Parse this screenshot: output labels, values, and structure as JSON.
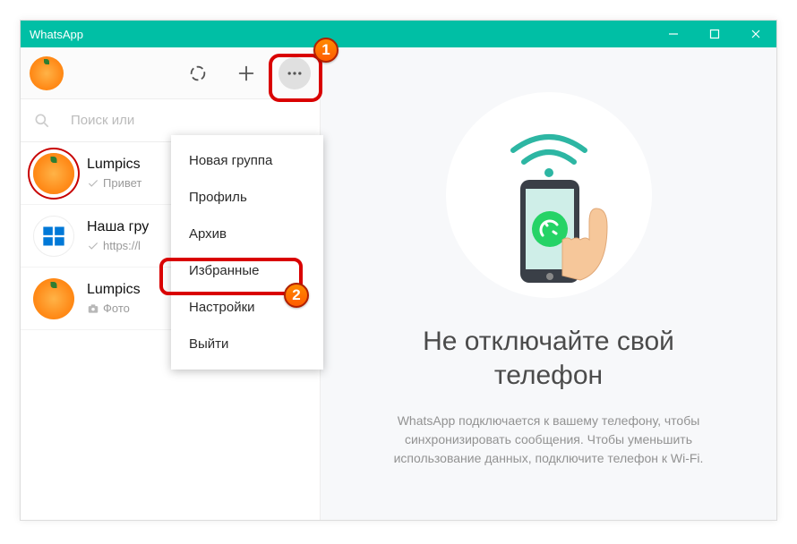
{
  "titlebar": {
    "title": "WhatsApp"
  },
  "header_actions": {
    "status_icon": "status-icon",
    "new_chat_icon": "plus-icon",
    "menu_icon": "dots-icon"
  },
  "search": {
    "placeholder": "Поиск или"
  },
  "chats": [
    {
      "name": "Lumpics",
      "sub_icon": "checkmark-icon",
      "sub": "Привет"
    },
    {
      "name": "Наша гру",
      "sub_icon": "checkmark-icon",
      "sub": "https://l"
    },
    {
      "name": "Lumpics",
      "sub_icon": "camera-icon",
      "sub": "Фото"
    }
  ],
  "menu": {
    "items": [
      "Новая группа",
      "Профиль",
      "Архив",
      "Избранные",
      "Настройки",
      "Выйти"
    ]
  },
  "main": {
    "title_line1": "Не отключайте свой",
    "title_line2": "телефон",
    "desc": "WhatsApp подключается к вашему телефону, чтобы синхронизировать сообщения. Чтобы уменьшить использование данных, подключите телефон к Wi-Fi."
  },
  "markers": {
    "one": "1",
    "two": "2"
  },
  "colors": {
    "accent": "#00bfa5",
    "callout": "#d90000",
    "marker": "#ff6a00"
  }
}
